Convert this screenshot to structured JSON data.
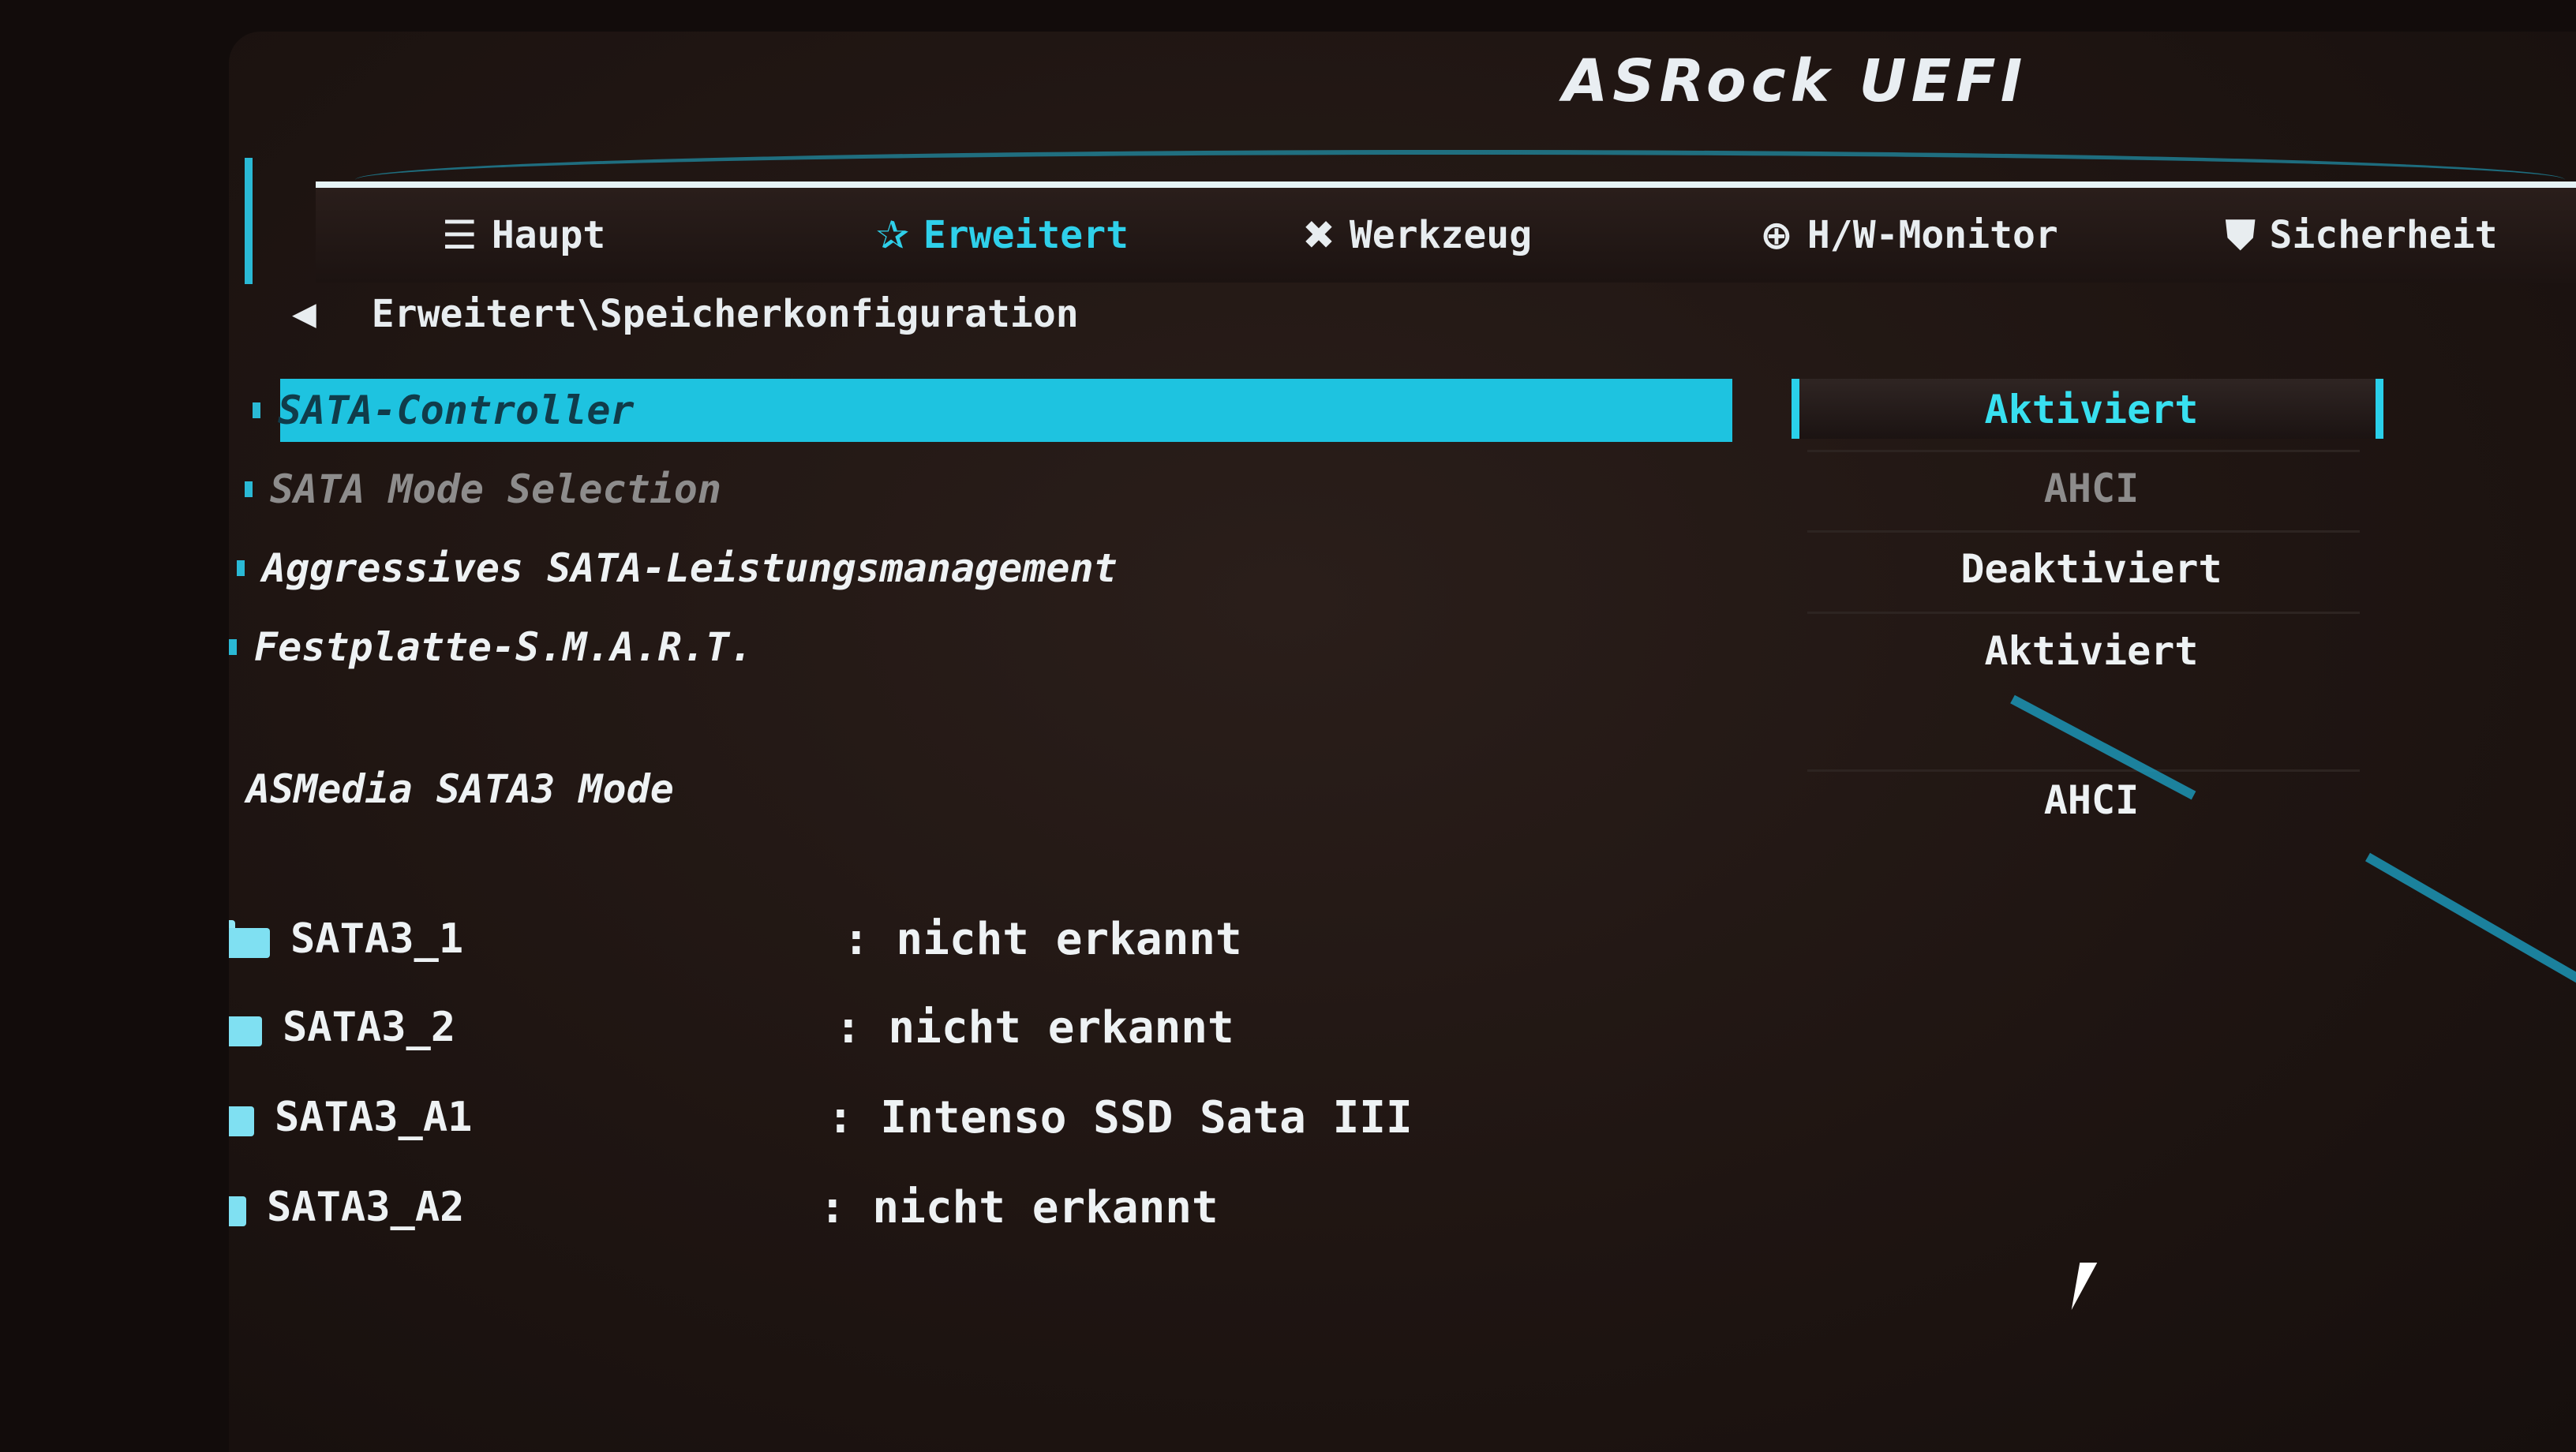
{
  "logo": "ASRock UEFI",
  "tabs": [
    {
      "label": "Haupt",
      "icon": "list-icon",
      "glyph": "☰"
    },
    {
      "label": "Erweitert",
      "icon": "star-icon",
      "glyph": "✰"
    },
    {
      "label": "Werkzeug",
      "icon": "tools-icon",
      "glyph": "✖"
    },
    {
      "label": "H/W-Monitor",
      "icon": "monitor-icon",
      "glyph": "⊕"
    },
    {
      "label": "Sicherheit",
      "icon": "shield-icon",
      "glyph": "⛊"
    }
  ],
  "breadcrumb": "Erweitert\\Speicherkonfiguration",
  "settings": [
    {
      "label": "SATA-Controller",
      "value": "Aktiviert"
    },
    {
      "label": "SATA Mode Selection",
      "value": "AHCI"
    },
    {
      "label": "Aggressives SATA-Leistungsmanagement",
      "value": "Deaktiviert"
    },
    {
      "label": "Festplatte-S.M.A.R.T.",
      "value": "Aktiviert"
    },
    {
      "label": "ASMedia SATA3 Mode",
      "value": "AHCI"
    }
  ],
  "drives": [
    {
      "name": "SATA3_1",
      "value": ": nicht erkannt"
    },
    {
      "name": "SATA3_2",
      "value": ": nicht erkannt"
    },
    {
      "name": "SATA3_A1",
      "value": ": Intenso  SSD Sata III"
    },
    {
      "name": "SATA3_A2",
      "value": ": nicht erkannt"
    }
  ],
  "colors": {
    "accent": "#1ec3e0",
    "background": "#1f1512",
    "text": "#eef2f4"
  }
}
